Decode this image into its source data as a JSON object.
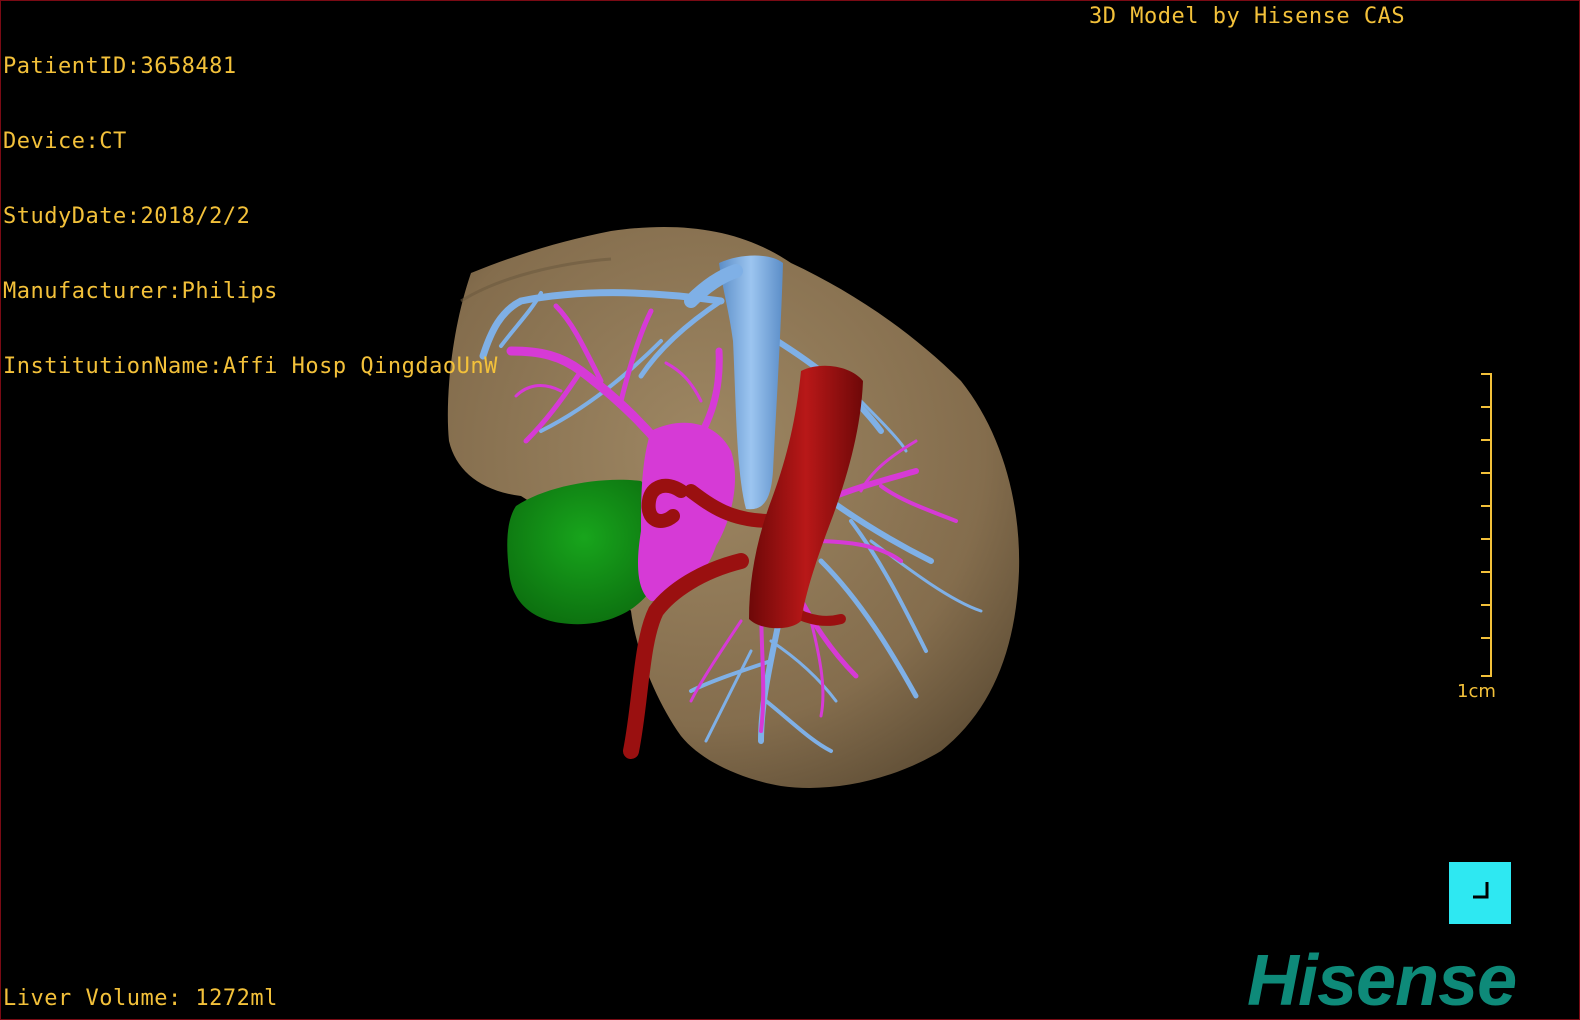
{
  "overlay": {
    "patient_id": "PatientID:3658481",
    "device": "Device:CT",
    "study_date": "StudyDate:2018/2/2",
    "manufacturer": "Manufacturer:Philips",
    "institution": "InstitutionName:Affi Hosp QingdaoUnW",
    "model_credit": "3D Model by Hisense CAS",
    "liver_volume": "Liver Volume: 1272ml"
  },
  "scale": {
    "label": "1cm"
  },
  "brand": {
    "logo_text": "Hisense"
  },
  "colors": {
    "overlay_text": "#f3c13a",
    "liver": "#8b7555",
    "hepatic_vein": "#7fb0e6",
    "portal_vein": "#d63ad6",
    "artery": "#9a1010",
    "gallbladder": "#0f8a12",
    "button": "#2ee8f2",
    "logo": "#0e8a79"
  },
  "icons": {
    "corner_button": "layout-corner-icon"
  }
}
